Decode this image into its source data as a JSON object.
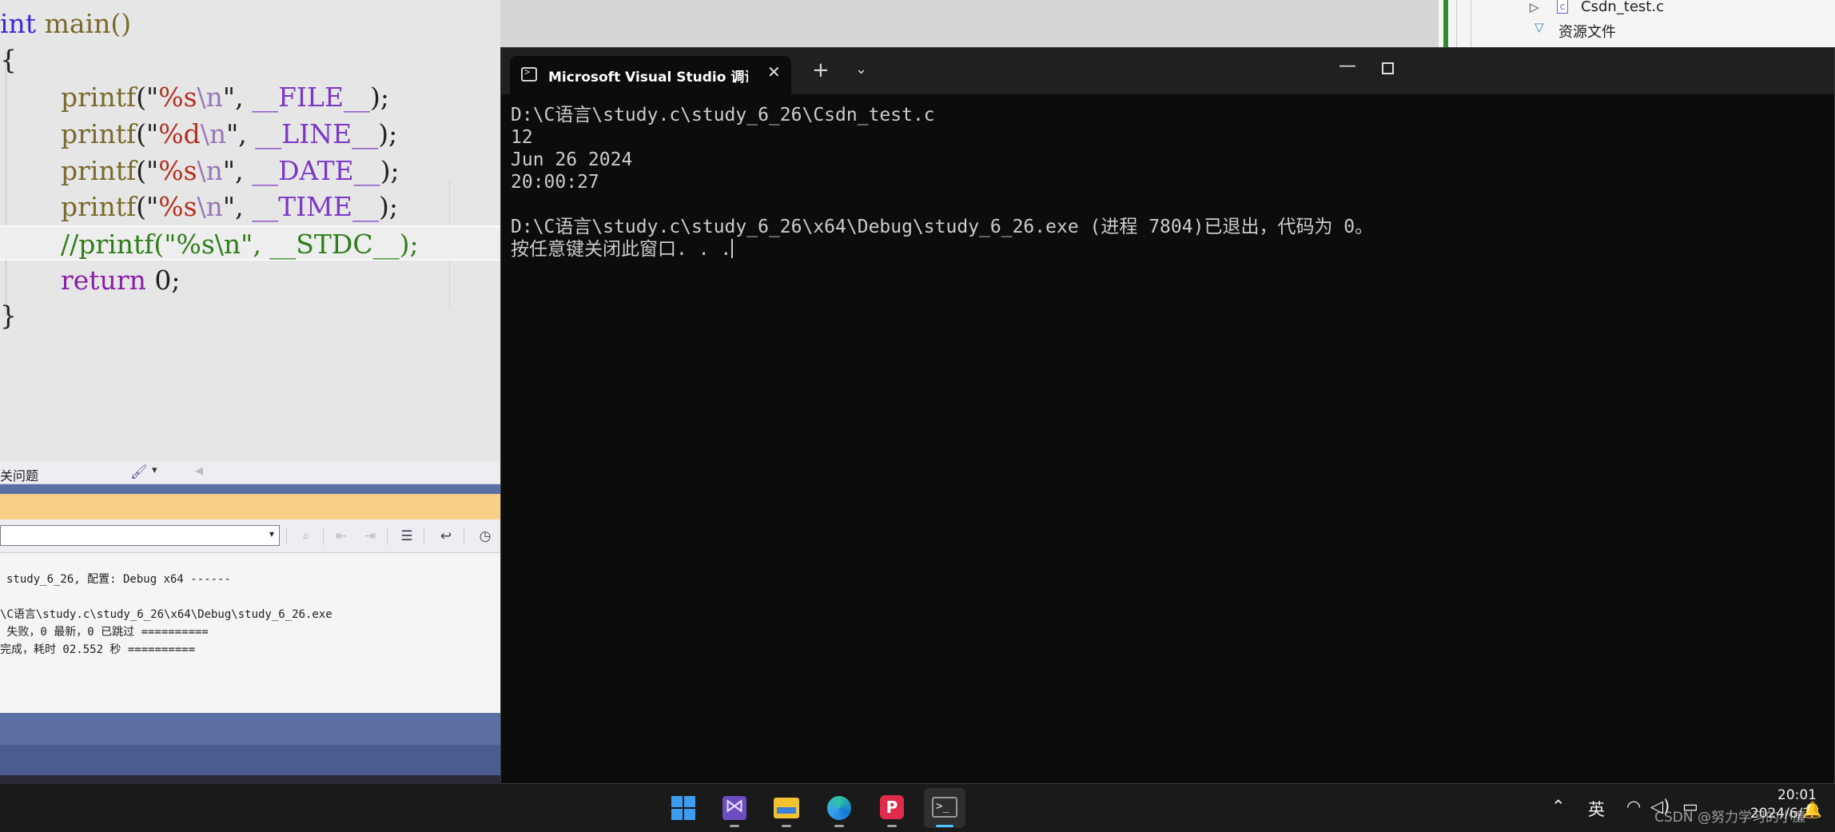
{
  "editor": {
    "lines": [
      {
        "kw": "int",
        "rest": " main()"
      },
      {
        "text": "{"
      },
      {
        "fn": "printf",
        "open": "(\"",
        "fmt": "%s",
        "esc": "\\n",
        "close": "\", ",
        "macro": "__FILE__",
        "end": ");"
      },
      {
        "fn": "printf",
        "open": "(\"",
        "fmt": "%d",
        "esc": "\\n",
        "close": "\", ",
        "macro": "__LINE__",
        "end": ");"
      },
      {
        "fn": "printf",
        "open": "(\"",
        "fmt": "%s",
        "esc": "\\n",
        "close": "\", ",
        "macro": "__DATE__",
        "end": ");"
      },
      {
        "fn": "printf",
        "open": "(\"",
        "fmt": "%s",
        "esc": "\\n",
        "close": "\", ",
        "macro": "__TIME__",
        "end": ");"
      },
      {
        "comment": "//printf(\"%s\\n\", __STDC__);"
      },
      {
        "kw": "return",
        "rest": " 0;"
      },
      {
        "text": "}"
      }
    ]
  },
  "error_list": {
    "label": "关问题"
  },
  "output_panel": {
    "lines": [
      "study_6_26, 配置: Debug x64 ------",
      "\\C语言\\study.c\\study_6_26\\x64\\Debug\\study_6_26.exe",
      " 失败，0 最新，0 已跳过 ==========",
      "完成，耗时 02.552 秒 =========="
    ]
  },
  "solution_explorer": {
    "file_item": "Csdn_test.c",
    "folder_item": "资源文件"
  },
  "terminal": {
    "tab_title": "Microsoft Visual Studio 调试控制台",
    "lines": [
      "D:\\C语言\\study.c\\study_6_26\\Csdn_test.c",
      "12",
      "Jun 26 2024",
      "20:00:27",
      "",
      "D:\\C语言\\study.c\\study_6_26\\x64\\Debug\\study_6_26.exe (进程 7804)已退出，代码为 0。",
      "按任意键关闭此窗口. . ."
    ]
  },
  "taskbar": {
    "apps": [
      "start-icon",
      "visual-studio-icon",
      "file-explorer-icon",
      "edge-icon",
      "powerpoint-icon",
      "terminal-icon"
    ],
    "tray": {
      "ime": "英",
      "time": "20:01",
      "date": "2024/6/26"
    }
  },
  "watermark": "CSDN @努力学习的小廉"
}
